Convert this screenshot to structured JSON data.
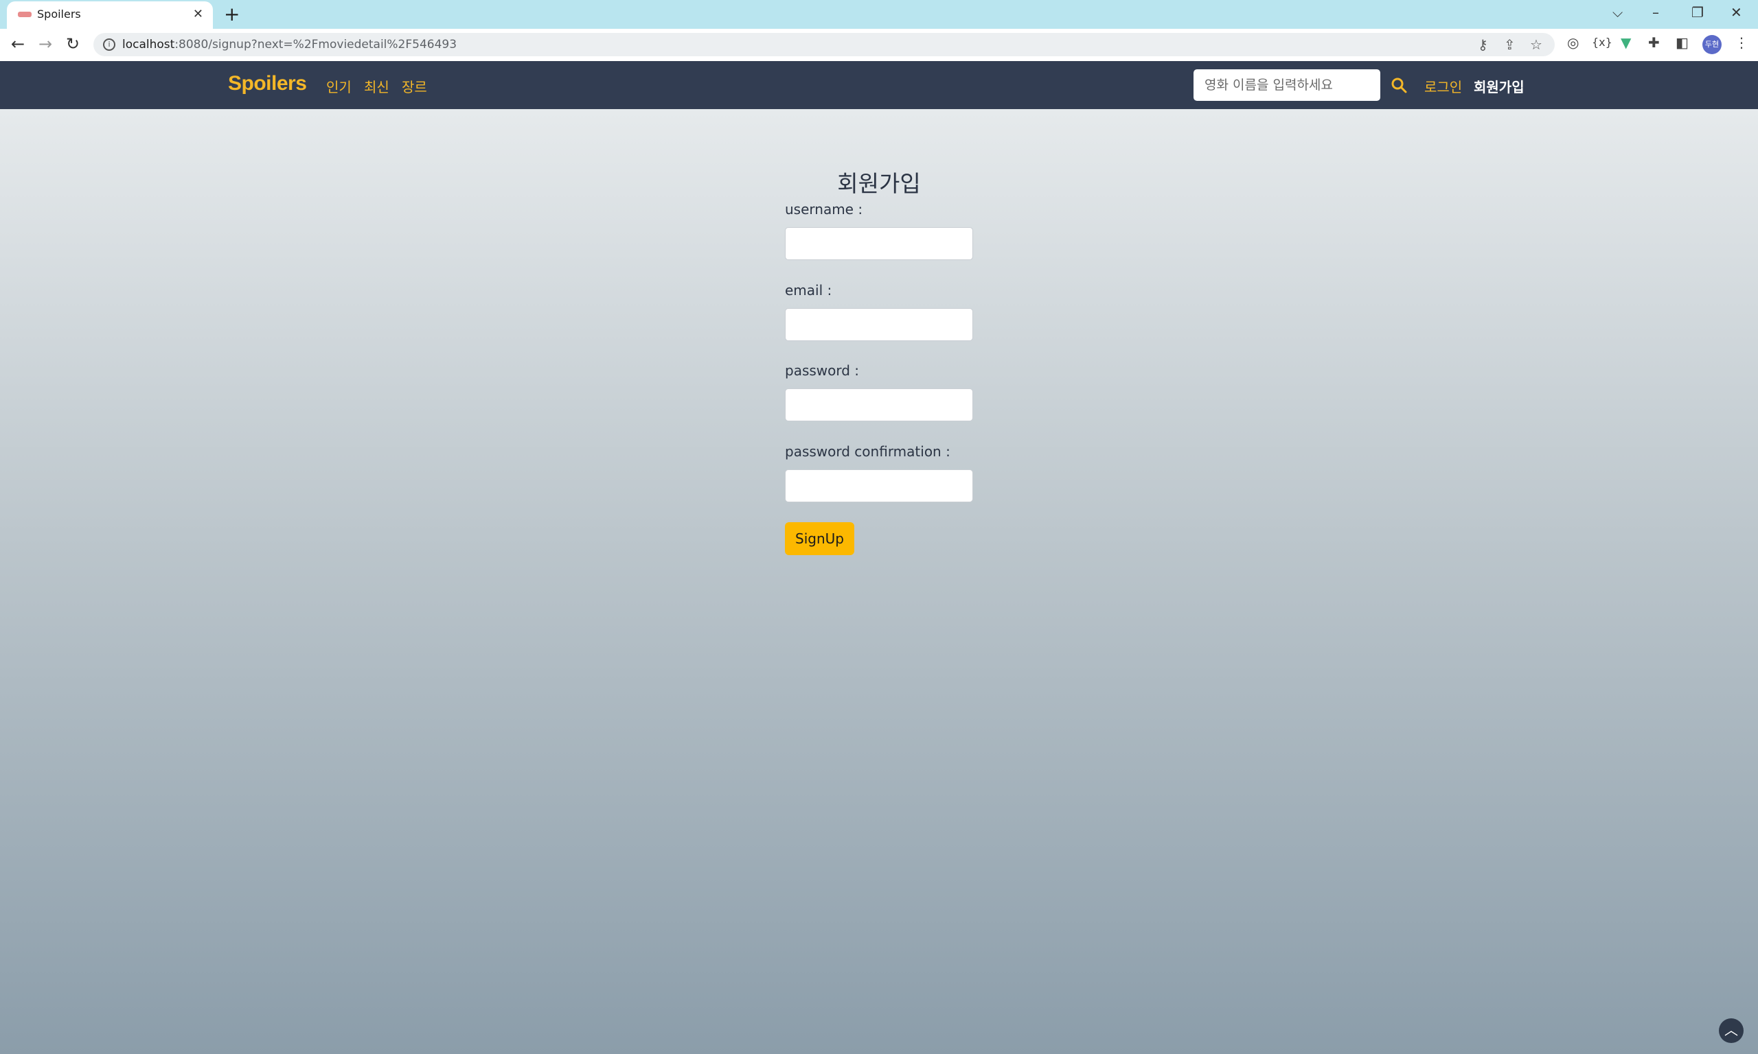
{
  "browser": {
    "tab_title": "Spoilers",
    "url_host": "localhost",
    "url_rest": ":8080/signup?next=%2Fmoviedetail%2F546493",
    "profile_initials": "두현"
  },
  "header": {
    "logo": "Spoilers",
    "nav": [
      "인기",
      "최신",
      "장르"
    ],
    "search_placeholder": "영화 이름을 입력하세요",
    "login_label": "로그인",
    "signup_label": "회원가입",
    "accent_color": "#f4b728",
    "bg_color": "#323d52"
  },
  "form": {
    "title": "회원가입",
    "fields": [
      {
        "label": "username :",
        "value": ""
      },
      {
        "label": "email :",
        "value": ""
      },
      {
        "label": "password :",
        "value": ""
      },
      {
        "label": "password confirmation :",
        "value": ""
      }
    ],
    "submit_label": "SignUp",
    "submit_color": "#fcb800"
  }
}
